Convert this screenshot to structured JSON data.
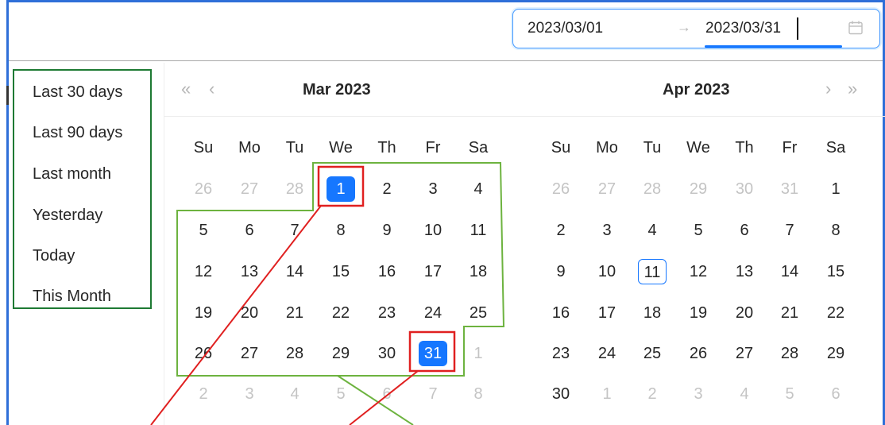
{
  "range_picker": {
    "start_value": "2023/03/01",
    "separator": "→",
    "end_value": "2023/03/31",
    "icon": "calendar-icon"
  },
  "presets": [
    "Last 30 days",
    "Last 90 days",
    "Last month",
    "Yesterday",
    "Today",
    "This Month"
  ],
  "left_panel": {
    "title": "Mar  2023",
    "nav_prev_year": "«",
    "nav_prev_month": "‹",
    "weekdays": [
      "Su",
      "Mo",
      "Tu",
      "We",
      "Th",
      "Fr",
      "Sa"
    ],
    "weeks": [
      [
        "26",
        "27",
        "28",
        "1",
        "2",
        "3",
        "4"
      ],
      [
        "5",
        "6",
        "7",
        "8",
        "9",
        "10",
        "11"
      ],
      [
        "12",
        "13",
        "14",
        "15",
        "16",
        "17",
        "18"
      ],
      [
        "19",
        "20",
        "21",
        "22",
        "23",
        "24",
        "25"
      ],
      [
        "26",
        "27",
        "28",
        "29",
        "30",
        "31",
        "1"
      ],
      [
        "2",
        "3",
        "4",
        "5",
        "6",
        "7",
        "8"
      ]
    ]
  },
  "right_panel": {
    "title": "Apr  2023",
    "nav_next_month": "›",
    "nav_next_year": "»",
    "weekdays": [
      "Su",
      "Mo",
      "Tu",
      "We",
      "Th",
      "Fr",
      "Sa"
    ],
    "weeks": [
      [
        "26",
        "27",
        "28",
        "29",
        "30",
        "31",
        "1"
      ],
      [
        "2",
        "3",
        "4",
        "5",
        "6",
        "7",
        "8"
      ],
      [
        "9",
        "10",
        "11",
        "12",
        "13",
        "14",
        "15"
      ],
      [
        "16",
        "17",
        "18",
        "19",
        "20",
        "21",
        "22"
      ],
      [
        "23",
        "24",
        "25",
        "26",
        "27",
        "28",
        "29"
      ],
      [
        "30",
        "1",
        "2",
        "3",
        "4",
        "5",
        "6"
      ]
    ]
  },
  "colors": {
    "accent": "#1677ff",
    "range_bg": "#e6f4ff",
    "annotation_green": "#6db33f",
    "annotation_red": "#e02020",
    "preset_box": "#1e7a33",
    "frame": "#2f6fd8"
  }
}
